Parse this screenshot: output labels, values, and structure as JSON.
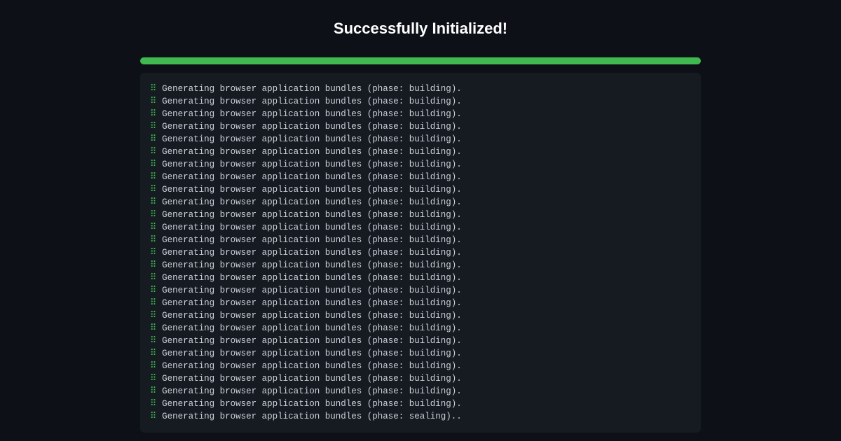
{
  "header": {
    "title": "Successfully Initialized!"
  },
  "progress": {
    "percent": 100,
    "color": "#3fb950"
  },
  "terminal": {
    "spinner_char": "⠿",
    "lines": [
      "Generating browser application bundles (phase: building).",
      "Generating browser application bundles (phase: building).",
      "Generating browser application bundles (phase: building).",
      "Generating browser application bundles (phase: building).",
      "Generating browser application bundles (phase: building).",
      "Generating browser application bundles (phase: building).",
      "Generating browser application bundles (phase: building).",
      "Generating browser application bundles (phase: building).",
      "Generating browser application bundles (phase: building).",
      "Generating browser application bundles (phase: building).",
      "Generating browser application bundles (phase: building).",
      "Generating browser application bundles (phase: building).",
      "Generating browser application bundles (phase: building).",
      "Generating browser application bundles (phase: building).",
      "Generating browser application bundles (phase: building).",
      "Generating browser application bundles (phase: building).",
      "Generating browser application bundles (phase: building).",
      "Generating browser application bundles (phase: building).",
      "Generating browser application bundles (phase: building).",
      "Generating browser application bundles (phase: building).",
      "Generating browser application bundles (phase: building).",
      "Generating browser application bundles (phase: building).",
      "Generating browser application bundles (phase: building).",
      "Generating browser application bundles (phase: building).",
      "Generating browser application bundles (phase: building).",
      "Generating browser application bundles (phase: building).",
      "Generating browser application bundles (phase: sealing).."
    ]
  }
}
